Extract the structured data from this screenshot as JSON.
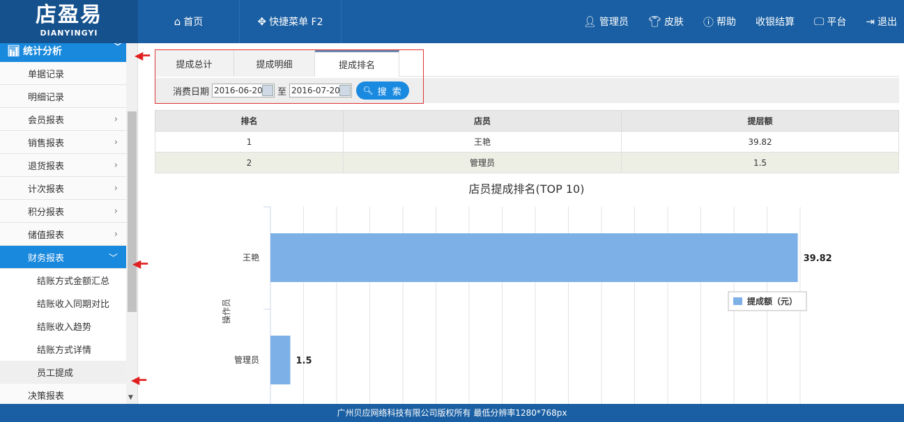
{
  "header": {
    "logo_cn": "店盈易",
    "logo_en": "DIANYINGYI",
    "home": "首页",
    "quick_menu": "快捷菜单 F2",
    "user": "管理员",
    "skin": "皮肤",
    "help": "帮助",
    "checkout": "收银结算",
    "platform": "平台",
    "logout": "退出"
  },
  "sidebar": {
    "section": "统计分析",
    "items": [
      {
        "label": "单据记录",
        "has_arrow": false
      },
      {
        "label": "明细记录",
        "has_arrow": false
      },
      {
        "label": "会员报表",
        "has_arrow": true
      },
      {
        "label": "销售报表",
        "has_arrow": true
      },
      {
        "label": "退货报表",
        "has_arrow": true
      },
      {
        "label": "计次报表",
        "has_arrow": true
      },
      {
        "label": "积分报表",
        "has_arrow": true
      },
      {
        "label": "储值报表",
        "has_arrow": true
      },
      {
        "label": "财务报表",
        "active": true
      }
    ],
    "subitems": [
      "结账方式金额汇总",
      "结账收入同期对比",
      "结账收入趋势",
      "结账方式详情",
      "员工提成"
    ],
    "next_item": "决策报表"
  },
  "tabs": [
    "提成总计",
    "提成明细",
    "提成排名"
  ],
  "search": {
    "date_label": "消费日期",
    "start_date": "2016-06-20",
    "to_label": "至",
    "end_date": "2016-07-20",
    "button": "搜 索"
  },
  "table": {
    "headers": [
      "排名",
      "店员",
      "提层额"
    ],
    "rows": [
      [
        "1",
        "王艳",
        "39.82"
      ],
      [
        "2",
        "管理员",
        "1.5"
      ]
    ]
  },
  "chart_data": {
    "type": "bar",
    "orientation": "horizontal",
    "title": "店员提成排名(TOP 10)",
    "ylabel": "操作员",
    "categories": [
      "王艳",
      "管理员"
    ],
    "series": [
      {
        "name": "提成额（元）",
        "values": [
          39.82,
          1.5
        ]
      }
    ],
    "data_labels": [
      "39.82",
      "1.5"
    ],
    "xlim": [
      0,
      40
    ],
    "grid": true,
    "color": "#7cb0e6"
  },
  "footer": "广州贝应网络科技有限公司版权所有 最低分辨率1280*768px"
}
